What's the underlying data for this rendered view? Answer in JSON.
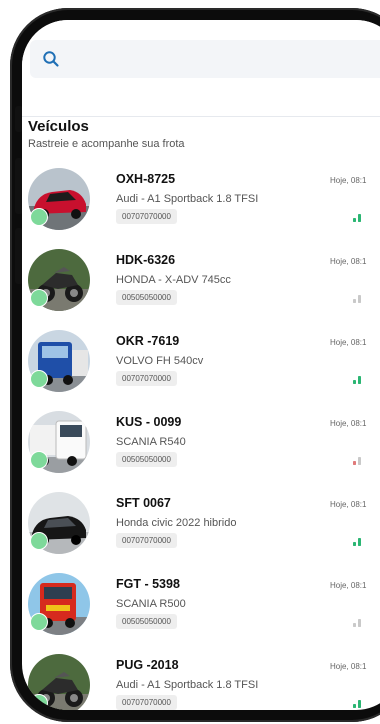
{
  "search": {
    "placeholder": ""
  },
  "header": {
    "title": "Veículos",
    "subtitle": "Rastreie e acompanhe sua frota"
  },
  "colors": {
    "accent": "#1f6fb5",
    "status_online": "#7ed99a",
    "signal_green": "#2bb673",
    "signal_grey": "#c9c9c9",
    "signal_red": "#e07a7a"
  },
  "vehicles": [
    {
      "plate": "OXH-8725",
      "model": "Audi - A1 Sportback 1.8 TFSI",
      "device": "00707070000",
      "time": "Hoje, 08:1",
      "avatar": "red-car",
      "signal": "strong"
    },
    {
      "plate": "HDK-6326",
      "model": "HONDA - X-ADV 745cc",
      "device": "00505050000",
      "time": "Hoje, 08:1",
      "avatar": "motorcycle",
      "signal": "weak"
    },
    {
      "plate": "OKR -7619",
      "model": "VOLVO FH 540cv",
      "device": "00707070000",
      "time": "Hoje, 08:1",
      "avatar": "blue-truck",
      "signal": "strong"
    },
    {
      "plate": "KUS - 0099",
      "model": "SCANIA R540",
      "device": "00505050000",
      "time": "Hoje, 08:1",
      "avatar": "white-truck",
      "signal": "weak-red"
    },
    {
      "plate": "SFT 0067",
      "model": "Honda civic 2022 hibrido",
      "device": "00707070000",
      "time": "Hoje, 08:1",
      "avatar": "black-car",
      "signal": "strong"
    },
    {
      "plate": "FGT - 5398",
      "model": "SCANIA R500",
      "device": "00505050000",
      "time": "Hoje, 08:1",
      "avatar": "red-truck",
      "signal": "weak"
    },
    {
      "plate": "PUG -2018",
      "model": "Audi - A1 Sportback 1.8 TFSI",
      "device": "00707070000",
      "time": "Hoje, 08:1",
      "avatar": "motorcycle",
      "signal": "strong"
    }
  ]
}
